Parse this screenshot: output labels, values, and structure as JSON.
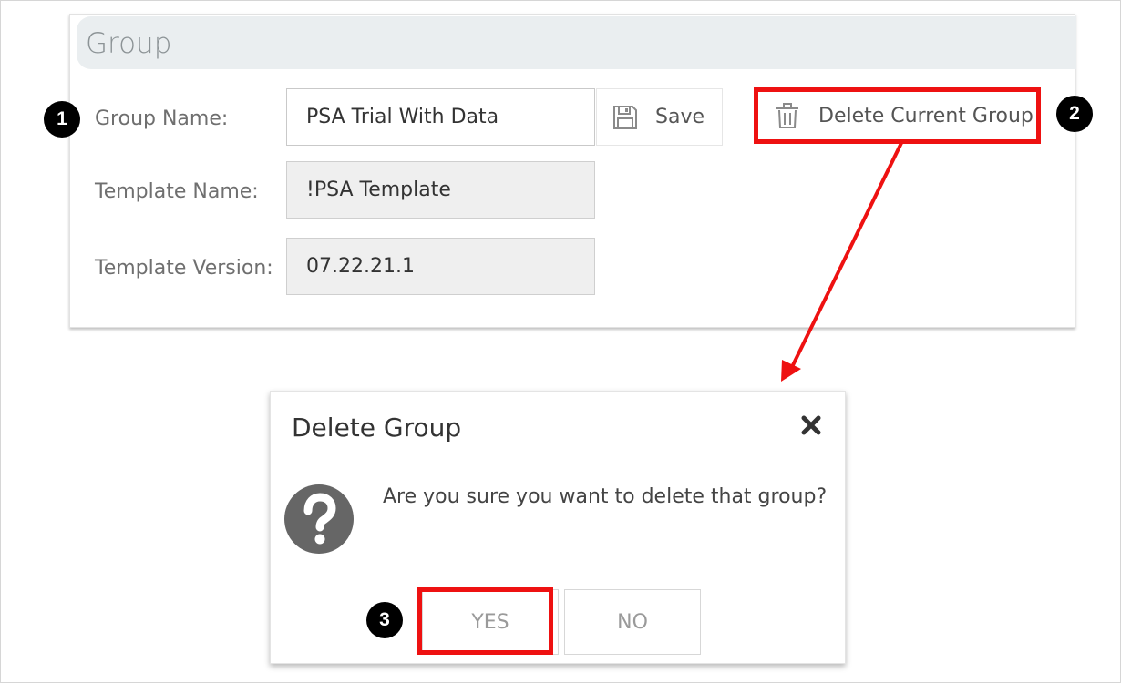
{
  "group_panel": {
    "title": "Group",
    "fields": [
      {
        "label": "Group Name:",
        "value": "PSA Trial With Data"
      },
      {
        "label": "Template Name:",
        "value": "!PSA Template"
      },
      {
        "label": "Template Version:",
        "value": "07.22.21.1"
      }
    ],
    "save_label": "Save",
    "delete_label": "Delete Current Group"
  },
  "callouts": {
    "badge_1": "1",
    "badge_2": "2",
    "badge_3": "3",
    "highlight_color": "#ee1111"
  },
  "dialog": {
    "title": "Delete Group",
    "message": "Are you sure you want to delete that group?",
    "yes_label": "YES",
    "no_label": "NO",
    "icon": "question-circle-icon",
    "close_icon": "close-icon"
  }
}
